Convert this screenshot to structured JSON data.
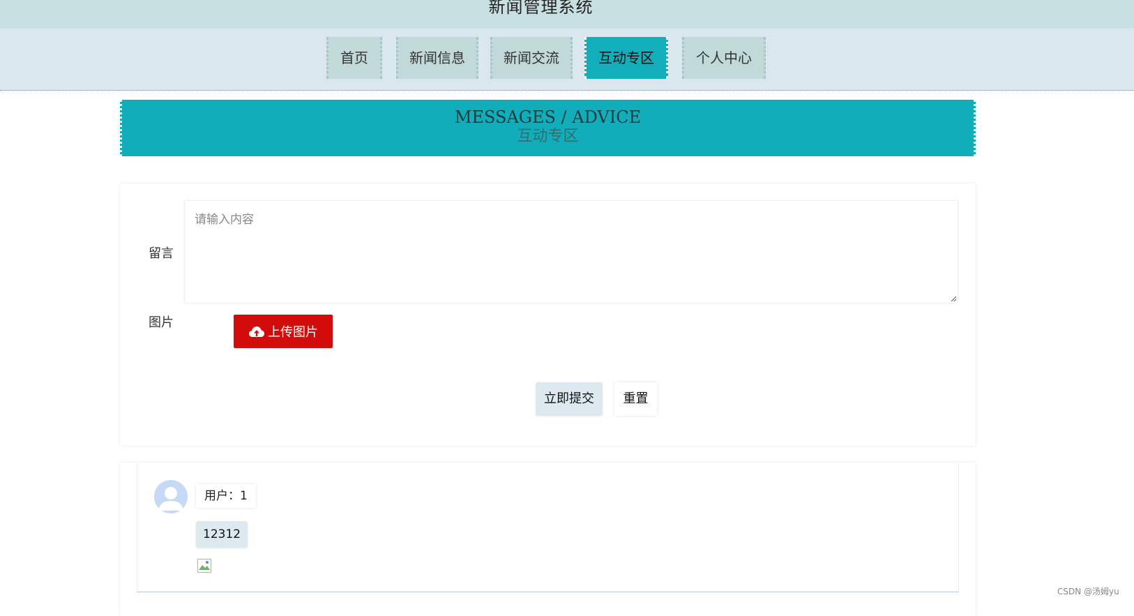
{
  "header": {
    "title": "新闻管理系统"
  },
  "nav": {
    "items": [
      {
        "label": "首页"
      },
      {
        "label": "新闻信息"
      },
      {
        "label": "新闻交流"
      },
      {
        "label": "互动专区"
      },
      {
        "label": "个人中心"
      }
    ],
    "active": "互动专区"
  },
  "banner": {
    "en": "MESSAGES / ADVICE",
    "cn": "互动专区"
  },
  "form": {
    "message_label": "留言",
    "message_placeholder": "请输入内容",
    "message_value": "",
    "image_label": "图片",
    "upload_label": "上传图片",
    "submit_label": "立即提交",
    "reset_label": "重置"
  },
  "comments": [
    {
      "user": "用户：1",
      "content": "12312"
    }
  ],
  "colors": {
    "header_bg": "#c8e0e1",
    "nav_bg": "#dbe7ee",
    "accent": "#12adbb",
    "upload_red": "#d20b0b"
  },
  "watermark": "CSDN @汤姆yu"
}
